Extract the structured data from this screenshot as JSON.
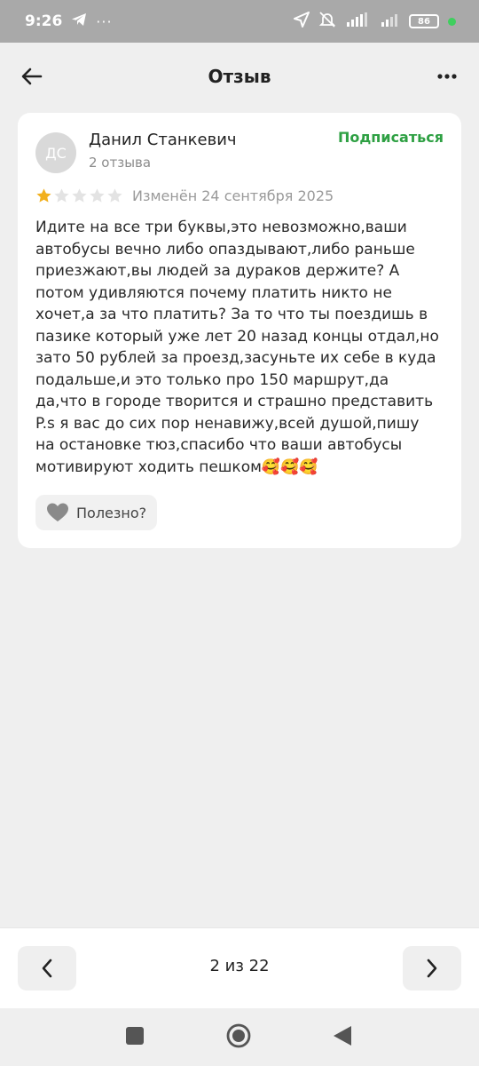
{
  "status_bar": {
    "time": "9:26",
    "battery": "86"
  },
  "header": {
    "title": "Отзыв"
  },
  "review": {
    "avatar_initials": "ДС",
    "author_name": "Данил Станкевич",
    "author_reviews": "2 отзыва",
    "subscribe_label": "Подписаться",
    "rating": 1,
    "max_rating": 5,
    "edited": "Изменён 24 сентября 2025",
    "text_lines": [
      "Идите на все три буквы,это невозможно,ваши",
      "автобусы вечно либо опаздывают,либо раньше",
      "приезжают,вы людей за дураков держите? А",
      "потом удивляются почему платить никто не",
      "хочет,а за что платить? За то что ты поездишь в",
      "пазике который уже лет 20 назад концы отдал,но",
      "зато 50 рублей за проезд,засуньте их себе в куда",
      "подальше,и это только про 150 маршрут,да",
      "да,что в городе творится и страшно представить",
      "P.s я вас до сих пор ненавижу,всей душой,пишу",
      "на остановке тюз,спасибо что ваши автобусы",
      "мотивируют ходить пешком🥰🥰🥰"
    ],
    "helpful_label": "Полезно?"
  },
  "pager": {
    "label": "2 из 22"
  },
  "colors": {
    "accent_green": "#2ea043",
    "star_filled": "#f2b01e",
    "star_empty": "#e3e3e3"
  }
}
